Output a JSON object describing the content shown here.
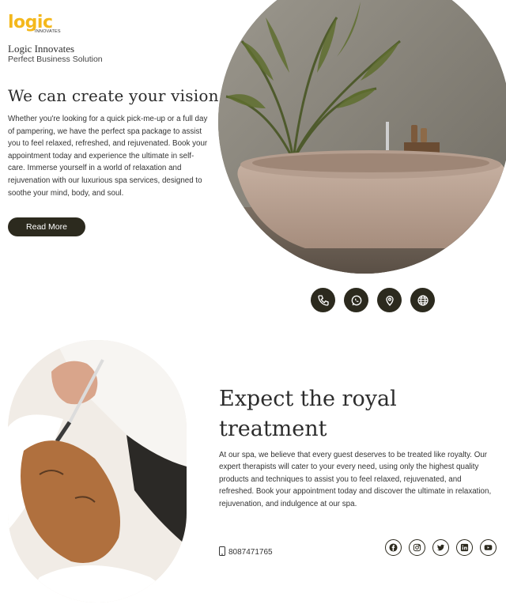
{
  "brand": {
    "logo_word": "logic",
    "logo_sub": "INNOVATES",
    "company_name": "Logic Innovates",
    "tagline": "Perfect Business Solution",
    "accent_color": "#f4b81c",
    "dark_color": "#2c2a1e"
  },
  "hero": {
    "headline": "We can create your vision",
    "paragraph": "Whether you're looking for a quick pick-me-up or a full day of pampering, we have the perfect spa package to assist you to feel relaxed, refreshed, and rejuvenated. Book your appointment today and experience the ultimate in self-care. Immerse yourself in a world of relaxation and rejuvenation with our luxurious spa services, designed to soothe your mind, body, and soul.",
    "button_label": "Read More"
  },
  "contact_icons": [
    "phone-icon",
    "whatsapp-icon",
    "location-pin-icon",
    "globe-icon"
  ],
  "royal": {
    "headline": "Expect the royal treatment",
    "paragraph": "At our spa, we believe that every guest deserves to be treated like royalty. Our expert therapists will cater to your every need, using only the highest quality products and techniques to assist you to feel relaxed, rejuvenated, and refreshed. Book your appointment today and discover the ultimate in relaxation, rejuvenation, and indulgence at our spa."
  },
  "phone": "8087471765",
  "social_icons": [
    "facebook-icon",
    "instagram-icon",
    "twitter-icon",
    "linkedin-icon",
    "youtube-icon"
  ]
}
